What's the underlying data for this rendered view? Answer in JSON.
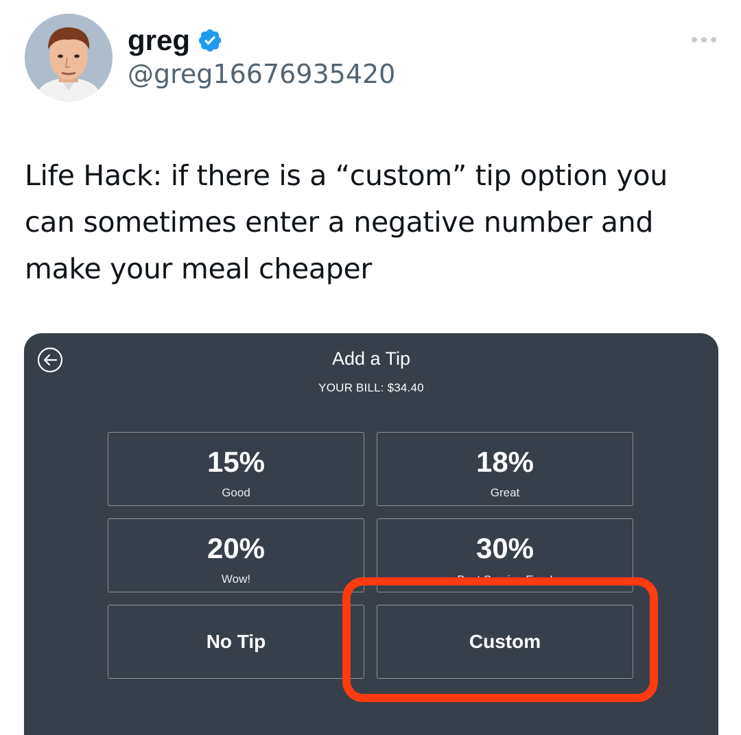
{
  "user": {
    "display_name": "greg",
    "handle": "@greg16676935420",
    "verified": true,
    "avatar_icon": "profile-photo"
  },
  "tweet": {
    "text": "Life Hack: if there is a “custom” tip option you can sometimes enter a negative number and make your meal cheaper"
  },
  "tip_screen": {
    "title": "Add a Tip",
    "bill": "YOUR BILL: $34.40",
    "options": [
      {
        "percent": "15%",
        "label": "Good"
      },
      {
        "percent": "18%",
        "label": "Great"
      },
      {
        "percent": "20%",
        "label": "Wow!"
      },
      {
        "percent": "30%",
        "label": "Best Service Ever!"
      }
    ],
    "no_tip_label": "No Tip",
    "custom_label": "Custom"
  },
  "colors": {
    "verified_badge": "#1d9bf0",
    "panel_background": "#373f4a",
    "highlight": "#ff3b10"
  }
}
